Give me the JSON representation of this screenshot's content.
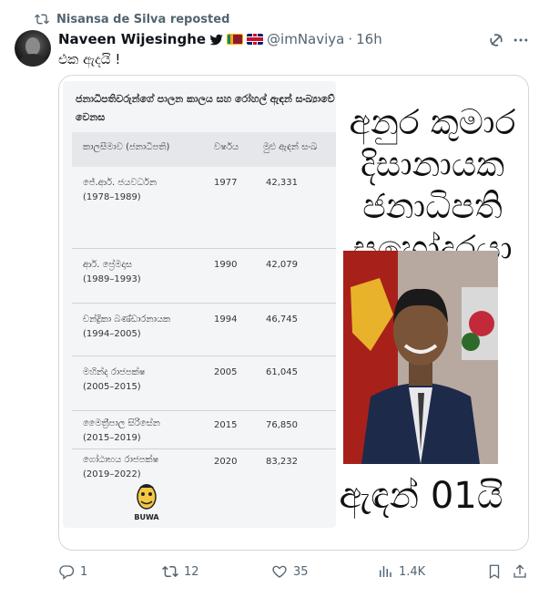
{
  "repost": {
    "icon": "repost-icon",
    "text": "Nisansa de Silva reposted"
  },
  "author": {
    "name": "Naveen Wijesinghe",
    "handle": "@imNaviya",
    "separator": "·",
    "time": "16h",
    "badges": [
      "verified-bird-icon",
      "sri-lanka-flag-icon",
      "uk-flag-icon"
    ]
  },
  "tweet": {
    "text": "එක ඇදයි !"
  },
  "media": {
    "table": {
      "title": "ජනාධිපතිවරුන්ගේ පාලන කාලය සහ රෝහල් ඇඳන් සංඛ්‍යාවේ වෙනස",
      "headers": [
        "කාලසීමාව (ජනාධිපති)",
        "වර්ෂය",
        "මුළු ඇඳන් සංඛ"
      ],
      "rows": [
        {
          "name": "ජේ.ආර්. ජයවර්ධන",
          "years": "(1978–1989)",
          "year": "1977",
          "beds": "42,331"
        },
        {
          "name": "ආර්. ප්‍රේමදාස",
          "years": "(1989–1993)",
          "year": "1990",
          "beds": "42,079"
        },
        {
          "name": "චන්ද්‍රිකා බණ්ඩාරනායක",
          "years": "(1994–2005)",
          "year": "1994",
          "beds": "46,745"
        },
        {
          "name": "මහින්ද රාජපක්ෂ",
          "years": "(2005–2015)",
          "year": "2005",
          "beds": "61,045"
        },
        {
          "name": "මෛත්‍රීපාල සිරිසේන",
          "years": "(2015–2019)",
          "year": "2015",
          "beds": "76,850"
        },
        {
          "name": "ගෝඨාභය රාජපක්ෂ",
          "years": "(2019–2022)",
          "year": "2020",
          "beds": "83,232"
        }
      ],
      "logo_text": "BUWA"
    },
    "caption_top": [
      "අනුර කුමාර",
      "දිසානායක",
      "ජනාධිපති",
      "සහෝදරයා"
    ],
    "caption_bottom": "ඇඳන් 01යි"
  },
  "actions": {
    "replies": "1",
    "reposts": "12",
    "likes": "35",
    "views": "1.4K"
  },
  "colors": {
    "secondary_text": "#536471",
    "border": "#cfd9de",
    "text": "#0f1419"
  }
}
